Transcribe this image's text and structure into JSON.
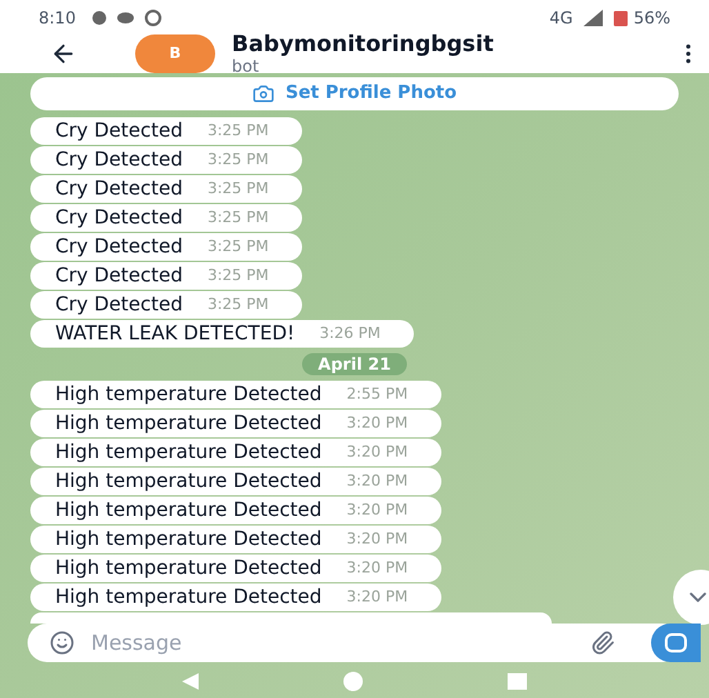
{
  "status_bar": {
    "time": "8:10",
    "network": "4G",
    "battery": "56%"
  },
  "header": {
    "avatar_letter": "B",
    "title": "Babymonitoringbgsit",
    "subtitle": "bot"
  },
  "profile_banner": {
    "label": "Set Profile Photo"
  },
  "messages": [
    {
      "kind": "message",
      "text": "Cry Detected",
      "time": "3:25 PM"
    },
    {
      "kind": "message",
      "text": "Cry Detected",
      "time": "3:25 PM"
    },
    {
      "kind": "message",
      "text": "Cry Detected",
      "time": "3:25 PM"
    },
    {
      "kind": "message",
      "text": "Cry Detected",
      "time": "3:25 PM"
    },
    {
      "kind": "message",
      "text": "Cry Detected",
      "time": "3:25 PM"
    },
    {
      "kind": "message",
      "text": "Cry Detected",
      "time": "3:25 PM"
    },
    {
      "kind": "message",
      "text": "Cry Detected",
      "time": "3:25 PM"
    },
    {
      "kind": "message",
      "text": "WATER LEAK DETECTED!",
      "time": "3:26 PM"
    },
    {
      "kind": "date",
      "text": "April 21"
    },
    {
      "kind": "message",
      "text": "High temperature Detected",
      "time": "2:55 PM"
    },
    {
      "kind": "message",
      "text": "High temperature Detected",
      "time": "3:20 PM"
    },
    {
      "kind": "message",
      "text": "High temperature Detected",
      "time": "3:20 PM"
    },
    {
      "kind": "message",
      "text": "High temperature Detected",
      "time": "3:20 PM"
    },
    {
      "kind": "message",
      "text": "High temperature Detected",
      "time": "3:20 PM"
    },
    {
      "kind": "message",
      "text": "High temperature Detected",
      "time": "3:20 PM"
    },
    {
      "kind": "message",
      "text": "High temperature Detected",
      "time": "3:20 PM"
    },
    {
      "kind": "message",
      "text": "High temperature Detected",
      "time": "3:20 PM"
    }
  ],
  "composer": {
    "placeholder": "Message"
  }
}
